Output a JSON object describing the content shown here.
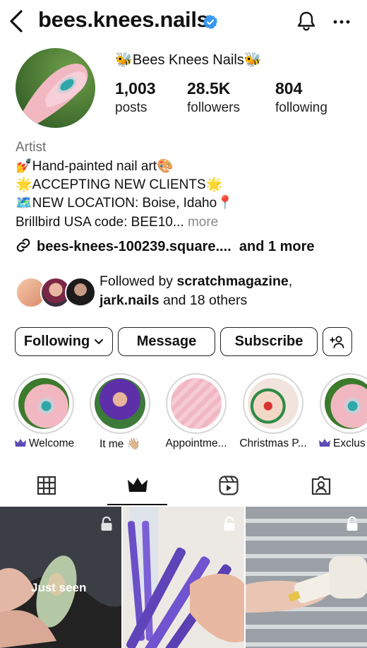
{
  "header": {
    "username": "bees.knees.nails",
    "icons": {
      "back": "back-chevron-icon",
      "verified": "verified-badge-icon",
      "bell": "bell-icon",
      "more": "more-horizontal-icon"
    }
  },
  "profile": {
    "display_name": "🐝Bees Knees Nails🐝",
    "stats": [
      {
        "value": "1,003",
        "label": "posts"
      },
      {
        "value": "28.5K",
        "label": "followers"
      },
      {
        "value": "804",
        "label": "following"
      }
    ],
    "category": "Artist",
    "bio": {
      "line1_emoji": "💅",
      "line1": "Hand-painted nail art",
      "line1_end": "🎨",
      "line2_emoji": "🌟",
      "line2": "ACCEPTING NEW CLIENTS",
      "line2_end": "🌟",
      "line3_emoji": "🗺️",
      "line3": "NEW LOCATION: Boise, Idaho",
      "line3_end": "📍",
      "line4": "Brillbird USA code: BEE10...",
      "line4_more": "more"
    },
    "link": "bees-knees-100239.square....",
    "link_more": "and 1 more"
  },
  "followed_by": {
    "prefix": "Followed by ",
    "user1": "scratchmagazine",
    "sep": ",",
    "user2": "jark.nails",
    "suffix": " and 18 others"
  },
  "actions": {
    "following": "Following",
    "message": "Message",
    "subscribe": "Subscribe"
  },
  "highlights": [
    {
      "label": "Welcome",
      "exclusive": true
    },
    {
      "label": "It me 👋🏼",
      "exclusive": false
    },
    {
      "label": "Appointme...",
      "exclusive": false
    },
    {
      "label": "Christmas P...",
      "exclusive": false
    },
    {
      "label": "Exclus",
      "exclusive": true
    }
  ],
  "tabs": [
    "grid-icon",
    "subscriber-crown-icon",
    "reels-icon",
    "tagged-icon"
  ],
  "grid": {
    "just_seen": "Just seen"
  },
  "colors": {
    "accent_verified": "#3897f0",
    "crown": "#5b4bb7"
  }
}
